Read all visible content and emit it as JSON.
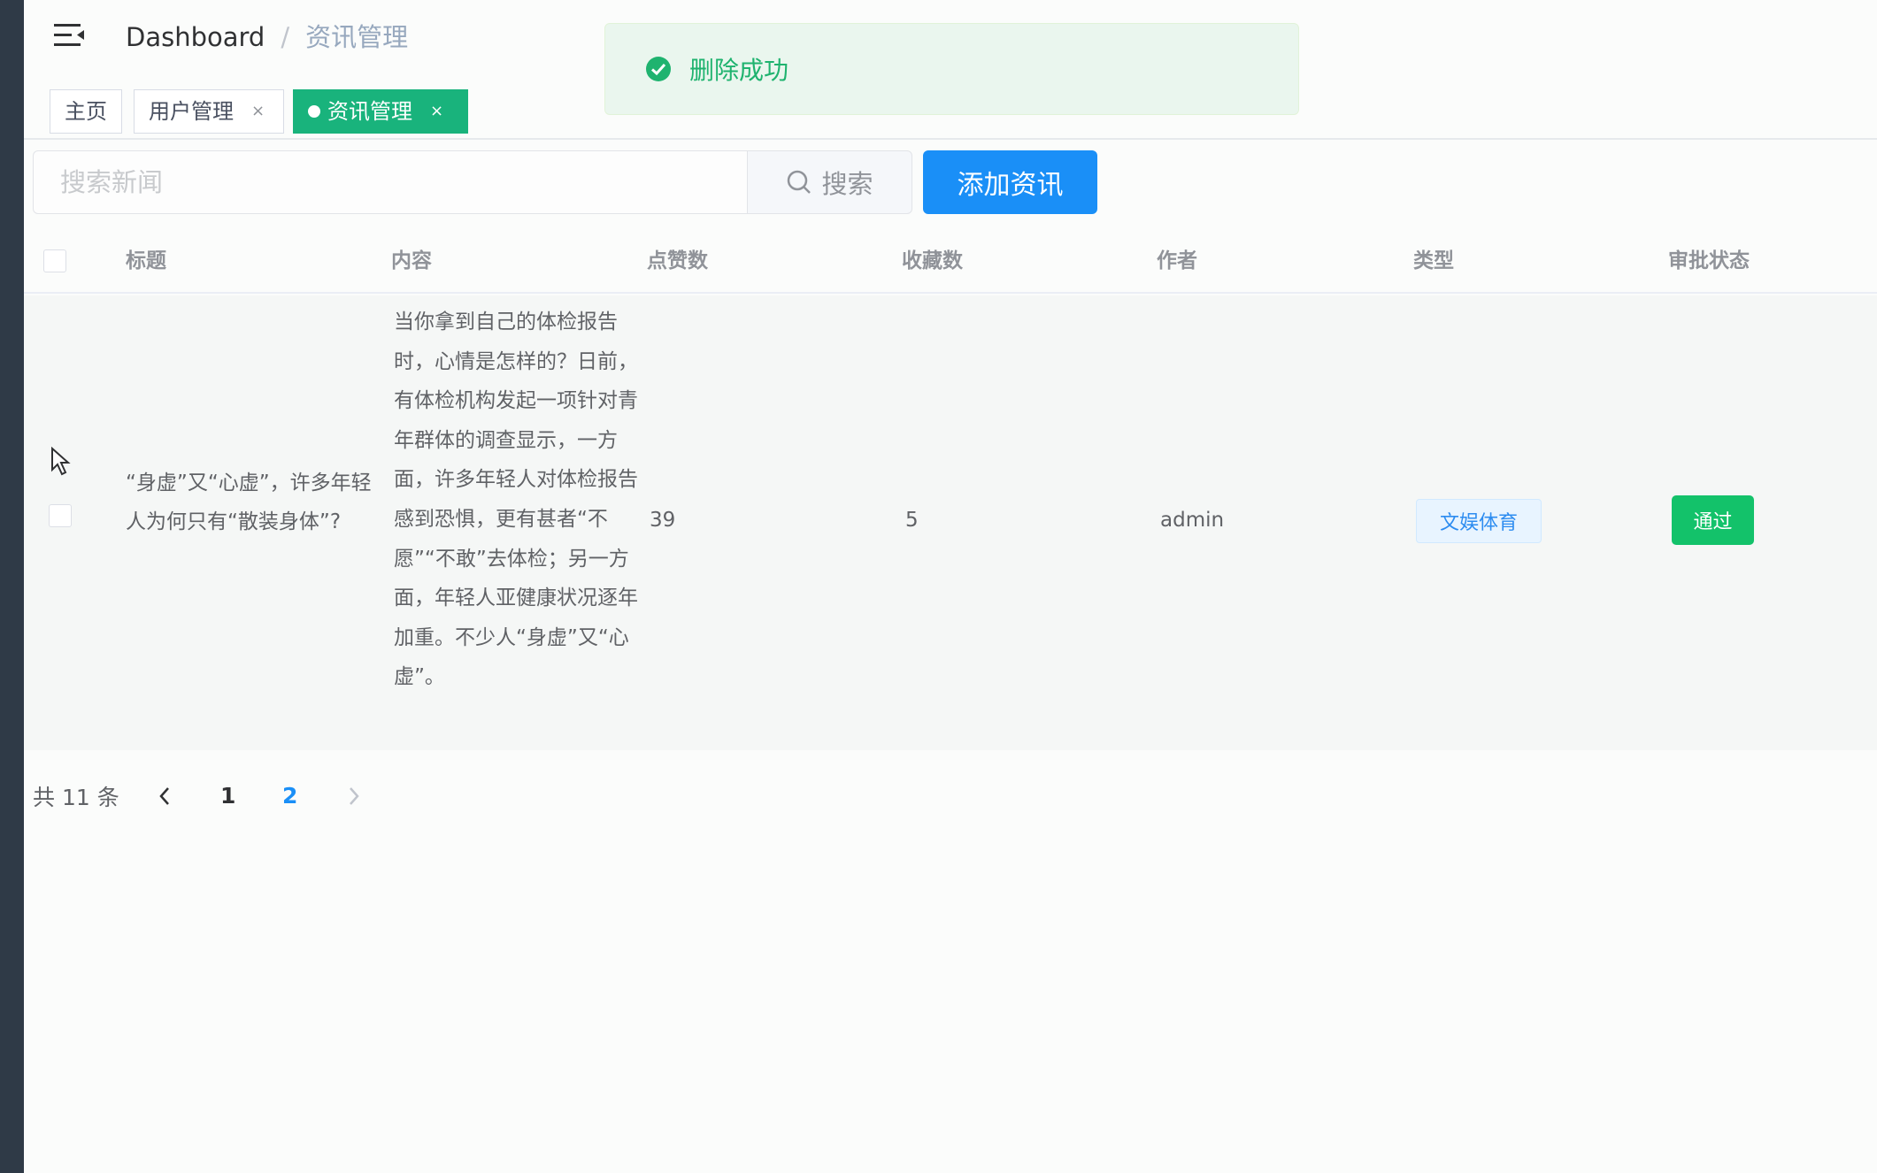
{
  "navbar": {
    "breadcrumb_home": "Dashboard",
    "breadcrumb_sep": "/",
    "breadcrumb_current": "资讯管理"
  },
  "tags": [
    {
      "label": "主页",
      "closable": false,
      "active": false
    },
    {
      "label": "用户管理",
      "closable": true,
      "active": false
    },
    {
      "label": "资讯管理",
      "closable": true,
      "active": true
    }
  ],
  "tag_close_glyph": "×",
  "toast": {
    "message": "删除成功",
    "color": "#1fb36f"
  },
  "search": {
    "placeholder": "搜索新闻",
    "value": "",
    "button_label": "搜索"
  },
  "add_button_label": "添加资讯",
  "table": {
    "columns": [
      "标题",
      "内容",
      "点赞数",
      "收藏数",
      "作者",
      "类型",
      "审批状态"
    ],
    "rows": [
      {
        "title": "“身虚”又“心虚”，许多年轻人为何只有“散装身体”?",
        "content": "当你拿到自己的体检报告时，心情是怎样的？日前，有体检机构发起一项针对青年群体的调查显示，一方面，许多年轻人对体检报告感到恐惧，更有甚者“不愿”“不敢”去体检；另一方面，年轻人亚健康状况逐年加重。不少人“身虚”又“心虚”。",
        "likes": "39",
        "favorites": "5",
        "author": "admin",
        "type": "文娱体育",
        "status": "通过"
      }
    ]
  },
  "pagination": {
    "total_text": "共 11 条",
    "pages": [
      "1",
      "2"
    ],
    "current_page": "2"
  },
  "colors": {
    "primary": "#1a8ff7",
    "success": "#13c26a",
    "active_tag": "#19b37c",
    "sidebar": "#2f3a47"
  }
}
